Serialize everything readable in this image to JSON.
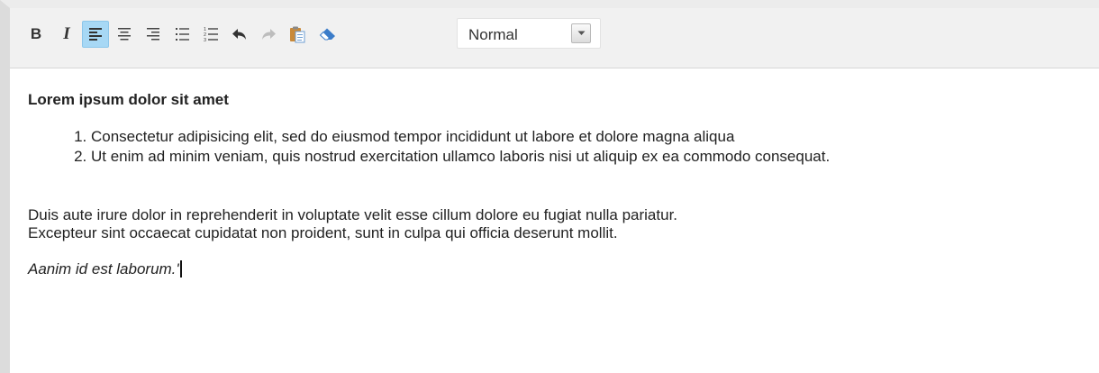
{
  "toolbar": {
    "buttons": [
      {
        "name": "bold",
        "icon": "bold-icon",
        "glyph": "B"
      },
      {
        "name": "italic",
        "icon": "italic-icon",
        "glyph": "I"
      },
      {
        "name": "align-left",
        "icon": "align-left-icon",
        "active": true
      },
      {
        "name": "align-center",
        "icon": "align-center-icon"
      },
      {
        "name": "align-right",
        "icon": "align-right-icon"
      },
      {
        "name": "bulleted-list",
        "icon": "bulleted-list-icon"
      },
      {
        "name": "numbered-list",
        "icon": "numbered-list-icon"
      },
      {
        "name": "undo",
        "icon": "undo-icon"
      },
      {
        "name": "redo",
        "icon": "redo-icon"
      },
      {
        "name": "paste",
        "icon": "paste-icon"
      },
      {
        "name": "clear-format",
        "icon": "eraser-icon"
      }
    ],
    "format_select": {
      "value": "Normal"
    }
  },
  "content": {
    "heading": "Lorem ipsum dolor sit amet",
    "list_items": [
      "Consectetur adipisicing elit, sed do eiusmod tempor incididunt ut labore et dolore magna aliqua",
      "Ut enim ad minim veniam, quis nostrud exercitation ullamco laboris nisi ut aliquip ex ea commodo consequat."
    ],
    "paragraph_line1": "Duis aute irure dolor in reprehenderit in voluptate velit esse cillum dolore eu fugiat nulla pariatur.",
    "paragraph_line2": "Excepteur sint occaecat cupidatat non proident, sunt in culpa qui officia deserunt mollit.",
    "italic_line": "Aanim id est laborum.'"
  },
  "colors": {
    "toolbar_bg": "#f1f1f1",
    "active_button": "#a7d8f5",
    "text": "#222222"
  }
}
